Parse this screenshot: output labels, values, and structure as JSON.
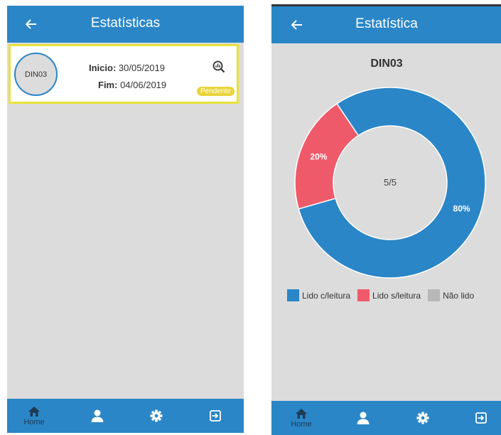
{
  "left": {
    "title": "Estatísticas",
    "card": {
      "avatar_text": "DIN03",
      "start_label": "Inicio:",
      "start_value": "30/05/2019",
      "end_label": "Fim:",
      "end_value": "04/06/2019",
      "status": "Pendente",
      "status_color": "#e9d43a"
    }
  },
  "right": {
    "title": "Estatística",
    "chart_title": "DIN03",
    "center_text": "5/5"
  },
  "nav": {
    "home_label": "Home"
  },
  "colors": {
    "primary": "#2a86c7",
    "red": "#ef5a6a",
    "grey": "#b8b8b8"
  },
  "chart_data": {
    "type": "pie",
    "title": "DIN03",
    "categories": [
      "Lido c/leitura",
      "Lido s/leitura",
      "Não lido"
    ],
    "values": [
      80,
      20,
      0
    ],
    "labels": [
      "80%",
      "20%",
      ""
    ],
    "colors": [
      "#2a86c7",
      "#ef5a6a",
      "#b8b8b8"
    ],
    "center_label": "5/5",
    "legend": "bottom"
  }
}
